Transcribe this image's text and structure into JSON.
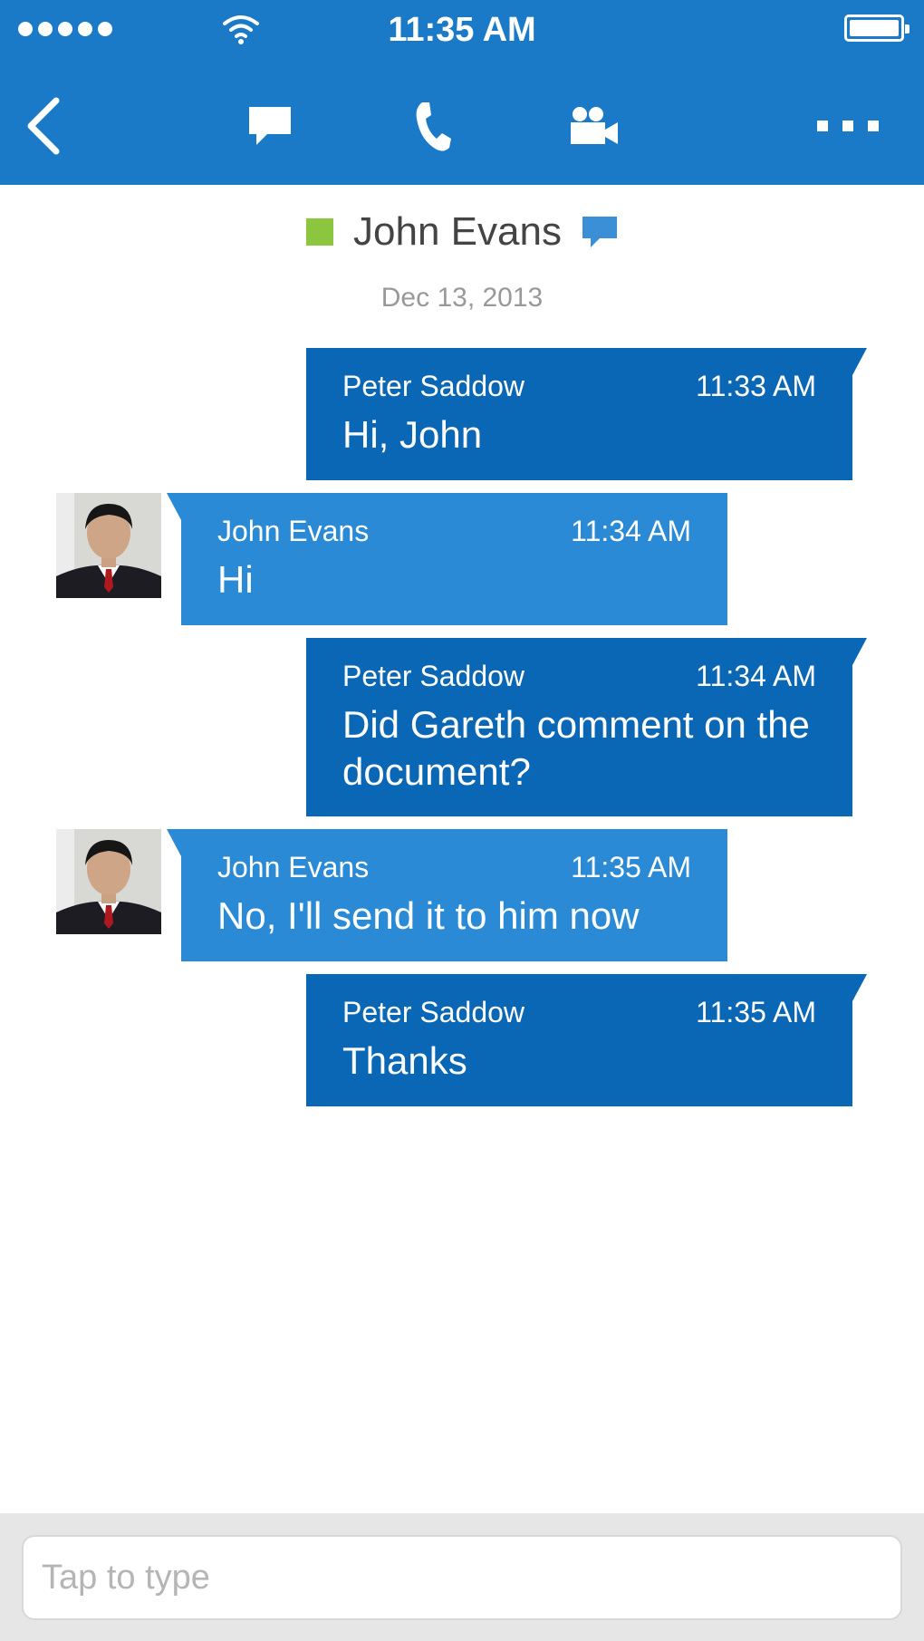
{
  "status_bar": {
    "time": "11:35 AM"
  },
  "navbar": {
    "buttons": [
      {
        "name": "back",
        "icon": "chevron-left-icon"
      },
      {
        "name": "chat",
        "icon": "chat-bubble-icon"
      },
      {
        "name": "call",
        "icon": "phone-icon"
      },
      {
        "name": "video",
        "icon": "video-camera-icon"
      },
      {
        "name": "more",
        "icon": "more-dots-icon"
      }
    ],
    "color": "#1a7ac7"
  },
  "conversation": {
    "contact_name": "John Evans",
    "presence_color": "#8cc63f",
    "date": "Dec 13, 2013"
  },
  "messages": [
    {
      "sender": "Peter Saddow",
      "time": "11:33 AM",
      "text": "Hi, John",
      "direction": "out"
    },
    {
      "sender": "John Evans",
      "time": "11:34 AM",
      "text": "Hi",
      "direction": "in"
    },
    {
      "sender": "Peter Saddow",
      "time": "11:34 AM",
      "text": "Did Gareth comment on the document?",
      "direction": "out"
    },
    {
      "sender": "John Evans",
      "time": "11:35 AM",
      "text": "No, I'll send it to him now",
      "direction": "in"
    },
    {
      "sender": "Peter Saddow",
      "time": "11:35 AM",
      "text": "Thanks",
      "direction": "out"
    }
  ],
  "colors": {
    "outgoing_bubble": "#0a67b5",
    "incoming_bubble": "#2a8ad6"
  },
  "composer": {
    "placeholder": "Tap to type",
    "value": ""
  }
}
